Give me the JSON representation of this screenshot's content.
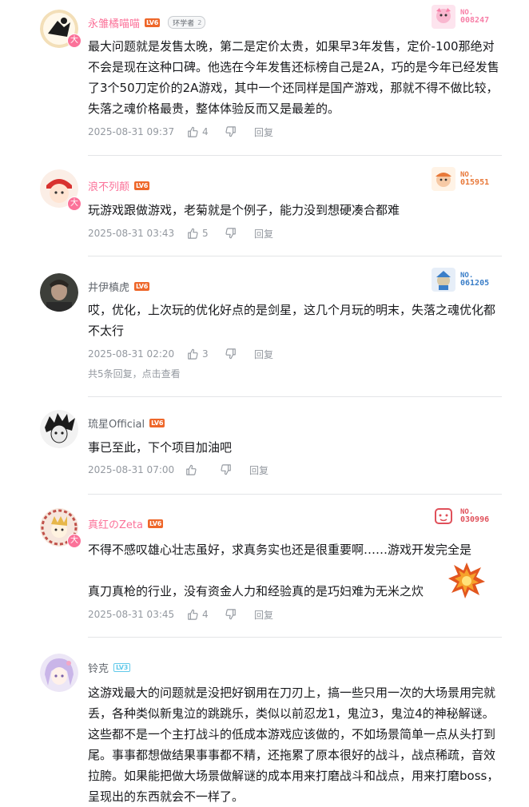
{
  "comments": [
    {
      "username": "永雏橘喵喵",
      "level": "LV6",
      "fan_badge": {
        "label": "环学者",
        "level": "2"
      },
      "card": {
        "no_label": "NO.",
        "number": "008247",
        "color": "#f77fa7"
      },
      "content": "最大问题就是发售太晚，第二是定价太贵，如果早3年发售，定价-100那绝对不会是现在这种口碑。他选在今年发售还标榜自己是2A，巧的是今年已经发售了3个50刀定价的2A游戏，其中一个还同样是国产游戏，那就不得不做比较，失落之魂价格最贵，整体体验反而又是最差的。",
      "time": "2025-08-31 09:37",
      "likes": "4",
      "reply_label": "回复"
    },
    {
      "username": "浪不列颠",
      "level": "LV6",
      "card": {
        "no_label": "NO.",
        "number": "015951",
        "color": "#e8793a"
      },
      "content": "玩游戏跟做游戏，老菊就是个例子，能力没到想硬凑合都难",
      "time": "2025-08-31 03:43",
      "likes": "5",
      "reply_label": "回复"
    },
    {
      "username": "井伊槙虎",
      "level": "LV6",
      "card": {
        "no_label": "NO.",
        "number": "061205",
        "color": "#3a7ec8"
      },
      "content": "哎，优化，上次玩的优化好点的是剑星，这几个月玩的明末，失落之魂优化都不太行",
      "time": "2025-08-31 02:20",
      "likes": "3",
      "reply_label": "回复",
      "sub_replies": "共5条回复，点击查看"
    },
    {
      "username": "琉星Official",
      "level": "LV6",
      "content": "事已至此，下个项目加油吧",
      "time": "2025-08-31 07:00",
      "likes": "",
      "reply_label": "回复"
    },
    {
      "username": "真红のZeta",
      "level": "LV6",
      "card": {
        "no_label": "NO.",
        "number": "030996",
        "color": "#e0505a"
      },
      "content_line1": "不得不感叹雄心壮志虽好，求真务实也还是很重要啊……游戏开发完全是",
      "content_line2": "真刀真枪的行业，没有资金人力和经验真的是巧妇难为无米之炊",
      "time": "2025-08-31 03:45",
      "likes": "4",
      "reply_label": "回复"
    },
    {
      "username": "铃克",
      "level": "LV3",
      "content": "这游戏最大的问题就是没把好钢用在刀刃上，搞一些只用一次的大场景用完就丢，各种类似新鬼泣的跳跳乐，类似以前忍龙1，鬼泣3，鬼泣4的神秘解谜。这些都不是一个主打战斗的低成本游戏应该做的，不如场景简单一点从头打到尾。事事都想做结果事事都不精，还拖累了原本很好的战斗，战点稀疏，音效拉胯。如果能把做大场景做解谜的成本用来打磨战斗和战点，用来打磨boss，呈现出的东西就会不一样了。"
    }
  ],
  "avatar_badge": "大",
  "colors": {
    "vip_name": "#fb7299",
    "text": "#18191c",
    "meta": "#9499a0",
    "divider": "#e3e5e7",
    "lv6": "#ee672a",
    "lv3": "#61c9ea"
  }
}
